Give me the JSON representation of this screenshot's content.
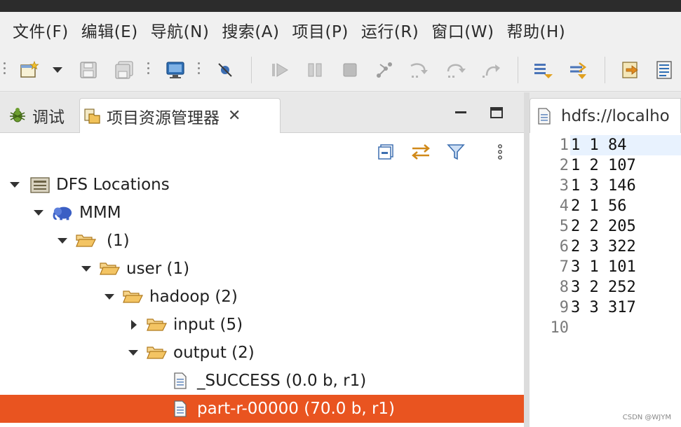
{
  "menubar": {
    "items": [
      "文件(F)",
      "编辑(E)",
      "导航(N)",
      "搜索(A)",
      "项目(P)",
      "运行(R)",
      "窗口(W)",
      "帮助(H)"
    ]
  },
  "toolbar": {
    "icons": [
      "new-wizard-icon",
      "dropdown-arrow-icon",
      "save-icon",
      "save-all-icon",
      "terminal-icon",
      "skip-breakpoints-icon",
      "resume-icon",
      "suspend-icon",
      "terminate-icon",
      "disconnect-icon",
      "step-into-icon",
      "step-over-icon",
      "step-return-icon",
      "next-annotation-icon",
      "previous-annotation-icon",
      "open-type-icon",
      "open-task-icon"
    ]
  },
  "left_panel": {
    "tabs": [
      {
        "label": "调试",
        "icon": "debug-bug-icon"
      },
      {
        "label": "项目资源管理器",
        "icon": "project-explorer-icon",
        "active": true
      }
    ],
    "close_glyph": "✕",
    "view_icons": [
      "collapse-all-icon",
      "link-with-editor-icon",
      "filter-icon",
      "view-menu-icon"
    ],
    "tree": [
      {
        "label": "DFS Locations",
        "icon": "dfs-locations-icon",
        "expanded": true
      },
      {
        "label": "MMM",
        "icon": "hadoop-elephant-icon",
        "expanded": true
      },
      {
        "label": "(1)",
        "icon": "folder-open-icon",
        "expanded": true
      },
      {
        "label": "user (1)",
        "icon": "folder-open-icon",
        "expanded": true
      },
      {
        "label": "hadoop (2)",
        "icon": "folder-open-icon",
        "expanded": true
      },
      {
        "label": "input (5)",
        "icon": "folder-open-icon",
        "expanded": false
      },
      {
        "label": "output (2)",
        "icon": "folder-open-icon",
        "expanded": true
      },
      {
        "label": "_SUCCESS (0.0 b, r1)",
        "icon": "file-icon"
      },
      {
        "label": "part-r-00000 (70.0 b, r1)",
        "icon": "file-icon",
        "selected": true
      }
    ]
  },
  "editor": {
    "tab_title": "hdfs://localho",
    "line_numbers": [
      "1",
      "2",
      "3",
      "4",
      "5",
      "6",
      "7",
      "8",
      "9",
      "10"
    ],
    "lines": [
      "1 1 84",
      "1 2 107",
      "1 3 146",
      "2 1 56",
      "2 2 205",
      "2 3 322",
      "3 1 101",
      "3 2 252",
      "3 3 317",
      ""
    ]
  },
  "watermark": "CSDN @WJYM",
  "colors": {
    "selection": "#e95420",
    "current_line": "#e8f2fe",
    "folder": "#e8a33c"
  }
}
